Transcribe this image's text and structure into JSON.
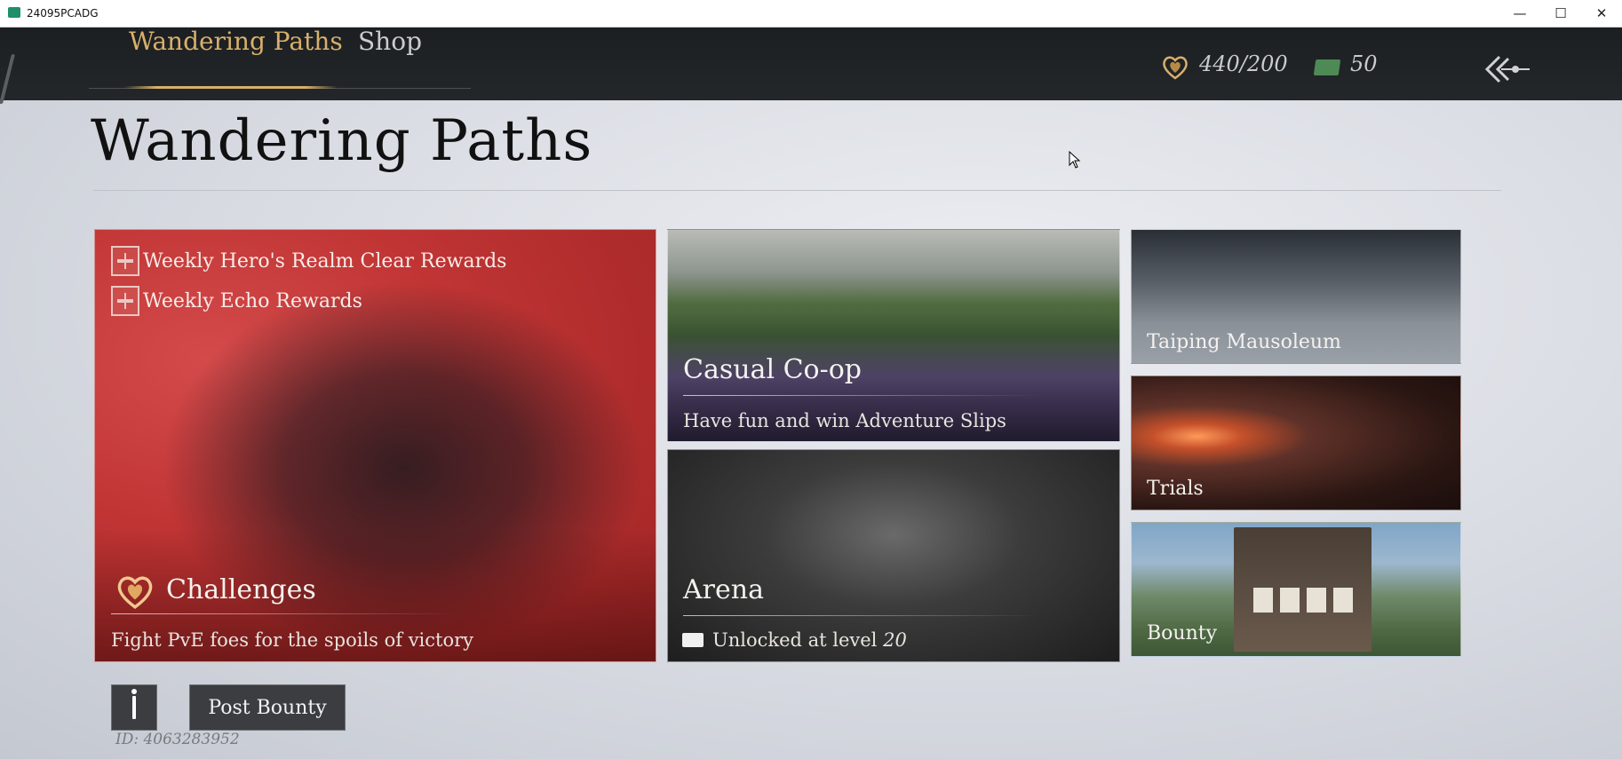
{
  "window": {
    "title": "24095PCADG",
    "minimize": "—",
    "maximize": "☐",
    "close": "✕"
  },
  "nav": {
    "tabs": [
      {
        "label": "Wandering Paths",
        "active": true
      },
      {
        "label": "Shop",
        "active": false
      }
    ],
    "currency": [
      {
        "icon": "heart-token-icon",
        "value": "440/200"
      },
      {
        "icon": "adventure-slip-icon",
        "value": "50"
      }
    ],
    "back_icon": "back-arrow-icon"
  },
  "page": {
    "title": "Wandering Paths"
  },
  "cards": {
    "challenges": {
      "rewards": [
        "Weekly Hero's Realm Clear Rewards",
        "Weekly Echo Rewards"
      ],
      "title": "Challenges",
      "subtitle": "Fight PvE foes for the spoils of victory"
    },
    "coop": {
      "title": "Casual Co-op",
      "subtitle": "Have fun and win Adventure Slips"
    },
    "arena": {
      "title": "Arena",
      "subtitle_prefix": "Unlocked at level",
      "level": "20"
    },
    "taiping": {
      "title": "Taiping Mausoleum"
    },
    "trials": {
      "title": "Trials"
    },
    "bounty": {
      "title": "Bounty"
    }
  },
  "footer": {
    "post_bounty_label": "Post Bounty",
    "player_id": "ID: 4063283952"
  },
  "colors": {
    "accent_gold": "#d8b06a",
    "nav_bg": "#1c1f22",
    "challenge_red": "#c03434"
  }
}
